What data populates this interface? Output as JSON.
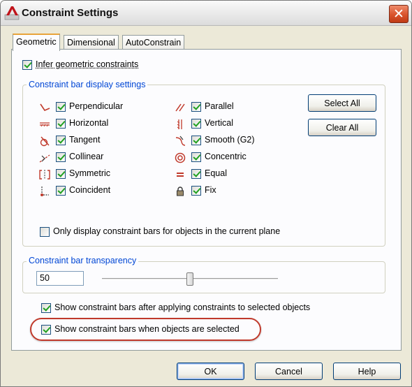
{
  "window": {
    "title": "Constraint Settings",
    "close_glyph": "✕"
  },
  "tabs": [
    {
      "label": "Geometric",
      "active": true
    },
    {
      "label": "Dimensional",
      "active": false
    },
    {
      "label": "AutoConstrain",
      "active": false
    }
  ],
  "infer": {
    "label": "Infer geometric constraints",
    "checked": true
  },
  "display_group": {
    "title": "Constraint bar display settings",
    "left_items": [
      {
        "label": "Perpendicular",
        "icon": "perpendicular-icon",
        "checked": true
      },
      {
        "label": "Horizontal",
        "icon": "horizontal-icon",
        "checked": true
      },
      {
        "label": "Tangent",
        "icon": "tangent-icon",
        "checked": true
      },
      {
        "label": "Collinear",
        "icon": "collinear-icon",
        "checked": true
      },
      {
        "label": "Symmetric",
        "icon": "symmetric-icon",
        "checked": true
      },
      {
        "label": "Coincident",
        "icon": "coincident-icon",
        "checked": true
      }
    ],
    "right_items": [
      {
        "label": "Parallel",
        "icon": "parallel-icon",
        "checked": true
      },
      {
        "label": "Vertical",
        "icon": "vertical-icon",
        "checked": true
      },
      {
        "label": "Smooth (G2)",
        "icon": "smooth-icon",
        "checked": true
      },
      {
        "label": "Concentric",
        "icon": "concentric-icon",
        "checked": true
      },
      {
        "label": "Equal",
        "icon": "equal-icon",
        "checked": true
      },
      {
        "label": "Fix",
        "icon": "lock-icon",
        "checked": true
      }
    ],
    "select_all": "Select All",
    "clear_all": "Clear All",
    "only_plane": {
      "label": "Only display constraint bars for objects in the current plane",
      "checked": false
    }
  },
  "transparency": {
    "title": "Constraint bar transparency",
    "value": "50",
    "slider_percent": 50
  },
  "show_after": {
    "label": "Show constraint bars after applying constraints to selected objects",
    "checked": true
  },
  "show_selected": {
    "label": "Show constraint bars when objects are selected",
    "checked": true
  },
  "buttons": {
    "ok": "OK",
    "cancel": "Cancel",
    "help": "Help"
  },
  "colors": {
    "group_title": "#0046d5",
    "highlight": "#c0392b",
    "check": "#21a121"
  }
}
